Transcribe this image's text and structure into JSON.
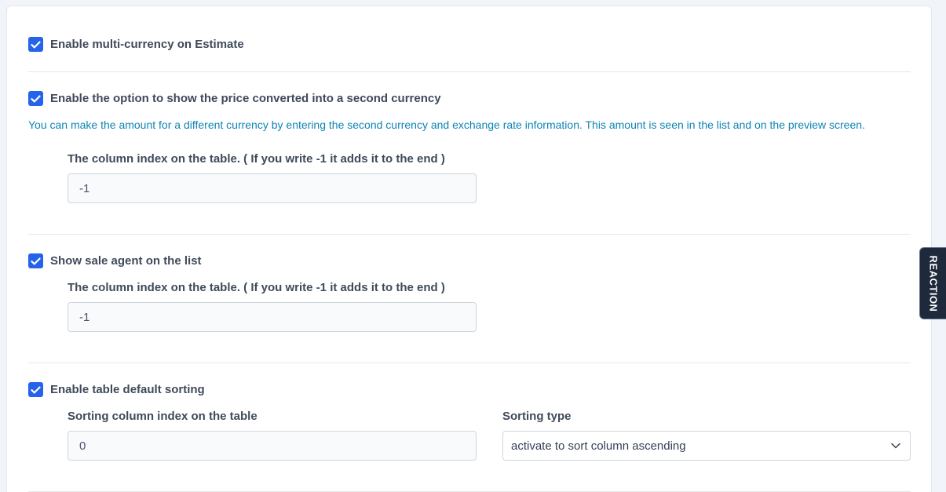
{
  "settings": {
    "multi_currency": {
      "label": "Enable multi-currency on Estimate",
      "checked": true
    },
    "second_currency": {
      "label": "Enable the option to show the price converted into a second currency",
      "checked": true,
      "help": "You can make the amount for a different currency by entering the second currency and exchange rate information. This amount is seen in the list and on the preview screen.",
      "column_label": "The column index on the table. ( If you write -1 it adds it to the end )",
      "column_value": "-1"
    },
    "sale_agent": {
      "label": "Show sale agent on the list",
      "checked": true,
      "column_label": "The column index on the table. ( If you write -1 it adds it to the end )",
      "column_value": "-1"
    },
    "default_sorting": {
      "label": "Enable table default sorting",
      "checked": true,
      "sort_column_label": "Sorting column index on the table",
      "sort_column_value": "0",
      "sort_type_label": "Sorting type",
      "sort_type_value": "activate to sort column ascending"
    }
  },
  "reaction_tab": {
    "label": "REACTION"
  },
  "colors": {
    "accent": "#2563eb",
    "help_text": "#0e84b5",
    "tab_bg": "#1e293b"
  },
  "icons": {
    "checkbox": "check-icon",
    "select": "chevron-down-icon"
  }
}
